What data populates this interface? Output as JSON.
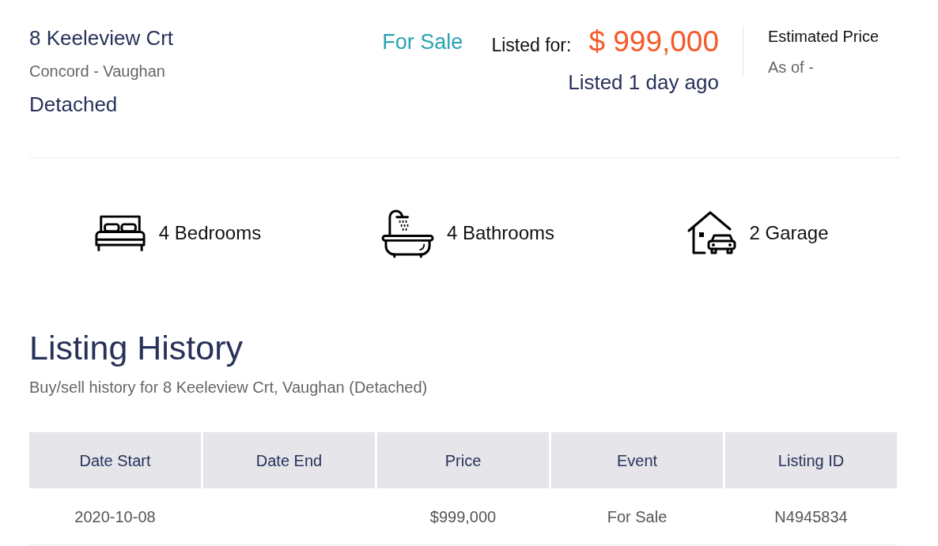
{
  "listing": {
    "address": "8 Keeleview Crt",
    "area": "Concord - Vaughan",
    "type": "Detached",
    "status": "For Sale",
    "price_label": "Listed for:",
    "price": "$ 999,000",
    "listed_ago": "Listed 1 day ago"
  },
  "estimate": {
    "title": "Estimated Price",
    "as_of": "As of -"
  },
  "features": [
    {
      "kind": "bedrooms",
      "label": "4 Bedrooms"
    },
    {
      "kind": "bathrooms",
      "label": "4 Bathrooms"
    },
    {
      "kind": "garage",
      "label": "2 Garage"
    }
  ],
  "history": {
    "title": "Listing History",
    "subtitle": "Buy/sell history for 8 Keeleview Crt, Vaughan (Detached)",
    "table": {
      "columns": [
        "Date Start",
        "Date End",
        "Price",
        "Event",
        "Listing ID"
      ],
      "rows": [
        [
          "2020-10-08",
          null,
          "$999,000",
          "For Sale",
          "N4945834"
        ]
      ]
    }
  }
}
